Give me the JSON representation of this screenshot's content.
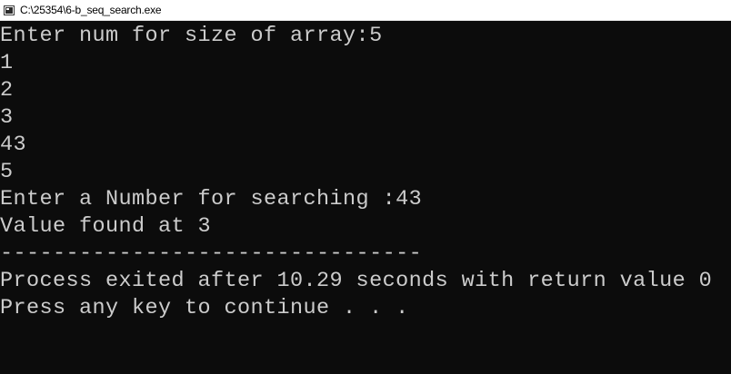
{
  "window": {
    "title": "C:\\25354\\6-b_seq_search.exe",
    "icon": "console-app-icon"
  },
  "console": {
    "lines": [
      "Enter num for size of array:5",
      "1",
      "2",
      "3",
      "43",
      "5",
      "Enter a Number for searching :43",
      "Value found at 3",
      "--------------------------------",
      "Process exited after 10.29 seconds with return value 0",
      "Press any key to continue . . ."
    ]
  },
  "colors": {
    "console_background": "#0c0c0c",
    "console_text": "#cccccc",
    "titlebar_background": "#ffffff",
    "titlebar_text": "#000000"
  }
}
